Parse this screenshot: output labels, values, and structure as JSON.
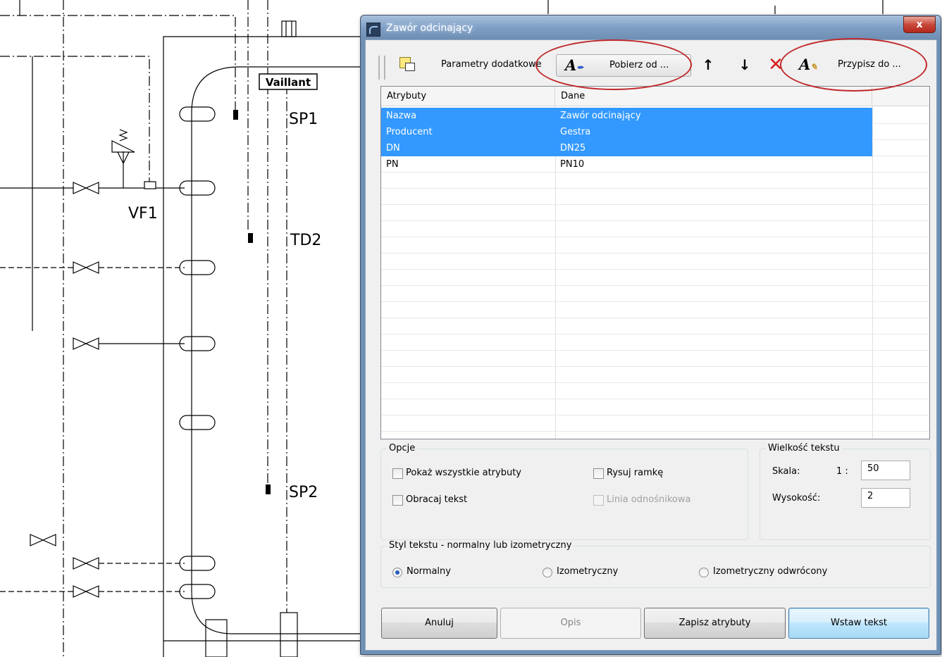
{
  "drawing": {
    "labels": [
      "SP1",
      "VF1",
      "TD2",
      "SP2"
    ],
    "logo": "Vaillant"
  },
  "dialog": {
    "title": "Zawór odcinający",
    "close_symbol": "x",
    "toolbar": {
      "params_label": "Parametry dodatkowe",
      "get_from_label": "Pobierz od ...",
      "assign_label": "Przypisz do ...",
      "up_icon": "arrow-up-icon",
      "down_icon": "arrow-down-icon",
      "delete_icon": "delete-x-icon"
    },
    "table": {
      "columns": [
        "Atrybuty",
        "Dane"
      ],
      "rows": [
        {
          "attr": "Nazwa",
          "value": "Zawór odcinający",
          "selected": true
        },
        {
          "attr": "Producent",
          "value": "Gestra",
          "selected": true
        },
        {
          "attr": "DN",
          "value": "DN25",
          "selected": true
        },
        {
          "attr": "PN",
          "value": "PN10",
          "selected": false
        }
      ]
    },
    "options": {
      "title": "Opcje",
      "show_all": "Pokaż wszystkie atrybuty",
      "draw_frame": "Rysuj ramkę",
      "rotate_text": "Obracaj tekst",
      "leader_line": "Linia odnośnikowa"
    },
    "text_size": {
      "title": "Wielkość tekstu",
      "scale_label": "Skala:",
      "scale_prefix": "1 :",
      "scale_value": "50",
      "height_label": "Wysokość:",
      "height_value": "2"
    },
    "text_style": {
      "title": "Styl tekstu - normalny lub izometryczny",
      "normal": "Normalny",
      "isometric": "Izometryczny",
      "isometric_reversed": "Izometryczny odwrócony",
      "selected": "normal"
    },
    "buttons": {
      "cancel": "Anuluj",
      "description": "Opis",
      "save_attrs": "Zapisz atrybuty",
      "insert_text": "Wstaw tekst"
    },
    "colors": {
      "selection": "#3399ff",
      "annotation_oval": "#c0282a",
      "title_bar": "#7d9dc4"
    }
  }
}
